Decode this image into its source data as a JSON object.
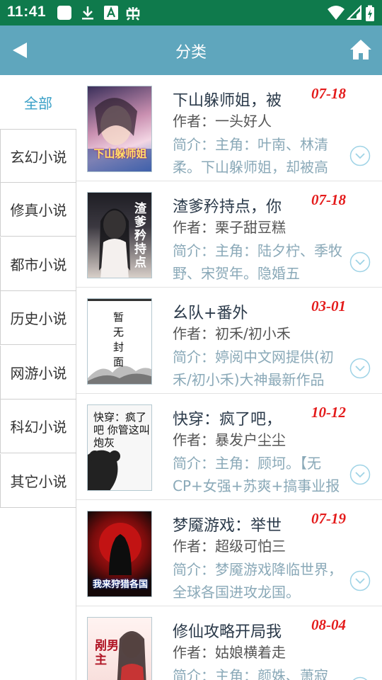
{
  "status_bar": {
    "time": "11:41"
  },
  "header": {
    "title": "分类"
  },
  "categories": [
    {
      "label": "全部"
    },
    {
      "label": "玄幻小说"
    },
    {
      "label": "修真小说"
    },
    {
      "label": "都市小说"
    },
    {
      "label": "历史小说"
    },
    {
      "label": "网游小说"
    },
    {
      "label": "科幻小说"
    },
    {
      "label": "其它小说"
    }
  ],
  "books": [
    {
      "title": "下山躲师姐，被",
      "author": "作者：一头好人",
      "date": "07-18",
      "intro": "简介：主角：叶南、林清柔。下山躲师姐，却被高",
      "cover_title": "下山躲师姐"
    },
    {
      "title": "渣爹矜持点，你",
      "author": "作者：栗子甜豆糕",
      "date": "07-18",
      "intro": "简介：主角：陆夕柠、季牧野、宋贺年。隐婚五",
      "cover_title": "渣爹矜持点"
    },
    {
      "title": "幺队+番外",
      "author": "作者：初禾/初小禾",
      "date": "03-01",
      "intro": "简介：婷阅中文网提供(初禾/初小禾)大神最新作品",
      "cover_title": "暂无封面"
    },
    {
      "title": "快穿：疯了吧，",
      "author": "作者：暴发户尘尘",
      "date": "10-12",
      "intro": "简介：主角：顾坷。【无CP+女强+苏爽+搞事业报",
      "cover_title": "快穿：疯了吧 你管这叫炮灰"
    },
    {
      "title": "梦魇游戏：举世",
      "author": "作者：超级可怕三",
      "date": "07-19",
      "intro": "简介：梦魇游戏降临世界，全球各国进攻龙国。",
      "cover_title": "我来狩猎各国"
    },
    {
      "title": "修仙攻略开局我",
      "author": "作者：姑娘横着走",
      "date": "08-04",
      "intro": "简介：主角：颜姝、萧寂",
      "cover_title": "剐男主"
    }
  ]
}
